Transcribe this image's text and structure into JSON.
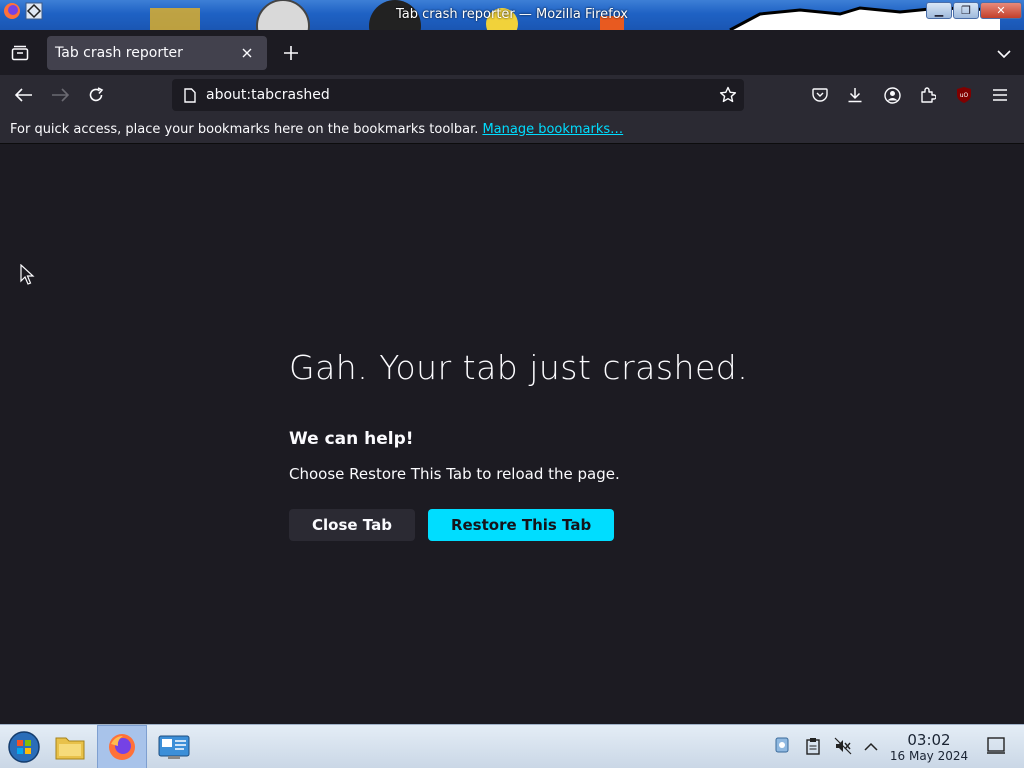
{
  "window": {
    "title": "Tab crash reporter — Mozilla Firefox",
    "controls": [
      "minimize",
      "maximize",
      "close"
    ]
  },
  "tabs": [
    {
      "label": "Tab crash reporter",
      "active": true
    }
  ],
  "navbar": {
    "url": "about:tabcrashed"
  },
  "bookmarks_toolbar": {
    "text": "For quick access, place your bookmarks here on the bookmarks toolbar.",
    "link": "Manage bookmarks…"
  },
  "crash_page": {
    "title": "Gah. Your tab just crashed.",
    "subtitle": "We can help!",
    "message": "Choose Restore This Tab to reload the page.",
    "close_button": "Close Tab",
    "restore_button": "Restore This Tab"
  },
  "taskbar": {
    "time": "03:02",
    "date": "16 May 2024"
  },
  "colors": {
    "accent": "#00ddff",
    "background": "#1c1b22",
    "toolbar": "#2b2a33",
    "tab_active": "#42414d"
  }
}
